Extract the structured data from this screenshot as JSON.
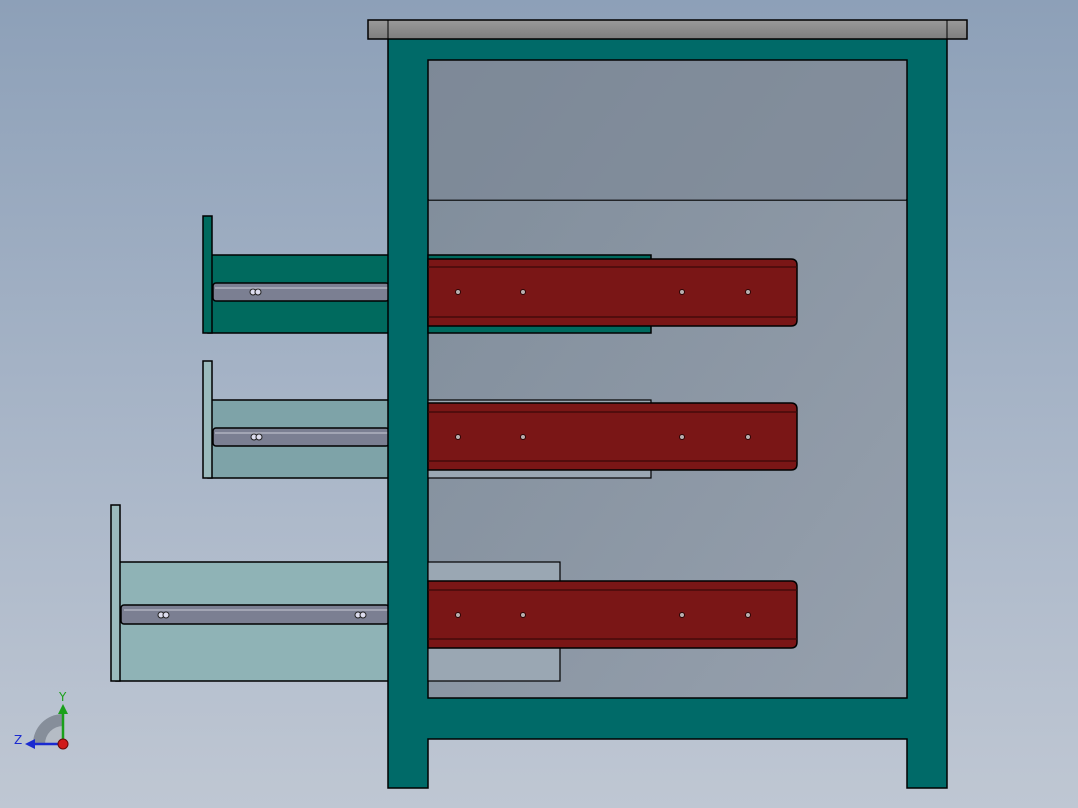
{
  "triad": {
    "y_label": "Y",
    "z_label": "Z",
    "y_color": "#1aa01a",
    "z_color": "#1a2ad0",
    "x_color": "#d01a1a"
  },
  "colors": {
    "cabinet": "#006a68",
    "top_plate": "#8a8a8a",
    "interior": "#828e9c",
    "rail": "#7a1616",
    "drawer_top_fill": "#006a5e",
    "drawer_glass_fill": "#8fb3b6",
    "slide_member": "#7b7f92"
  }
}
